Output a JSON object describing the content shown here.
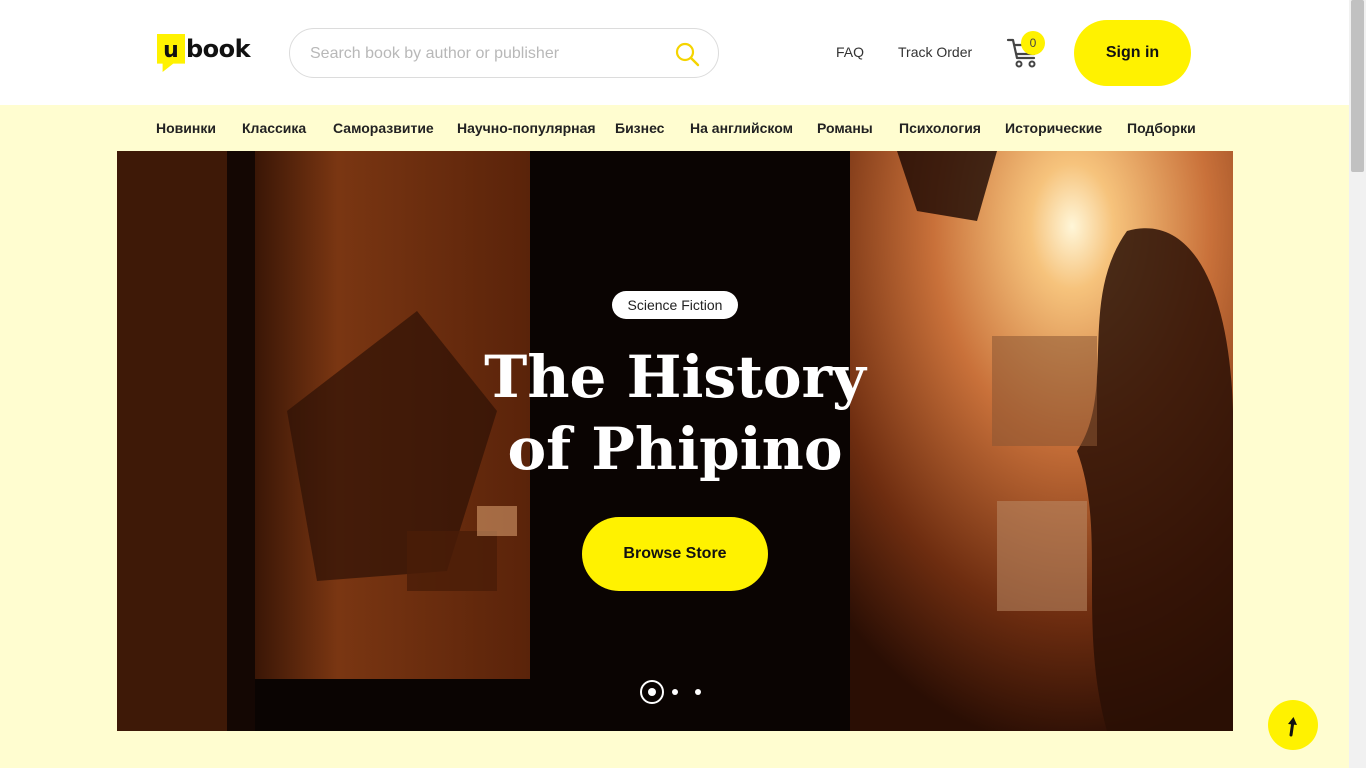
{
  "logo": {
    "badge_letter": "u",
    "text": "book"
  },
  "search": {
    "placeholder": "Search book by author or publisher",
    "value": ""
  },
  "header_links": {
    "faq": "FAQ",
    "track_order": "Track Order"
  },
  "cart": {
    "count": "0"
  },
  "sign_in_label": "Sign in",
  "categories": [
    "Новинки",
    "Классика",
    "Саморазвитие",
    "Научно-популярная",
    "Бизнес",
    "На английском",
    "Романы",
    "Психология",
    "Исторические",
    "Подборки"
  ],
  "hero": {
    "genre": "Science Fiction",
    "title_line1": "The History",
    "title_line2": "of Phipino",
    "cta": "Browse Store",
    "slides": 3,
    "active_slide": 1
  },
  "colors": {
    "accent": "#fff200",
    "page_bg": "#fffdd0",
    "header_bg": "#ffffff"
  },
  "icons": [
    "search-icon",
    "cart-icon",
    "arrow-up-icon"
  ]
}
